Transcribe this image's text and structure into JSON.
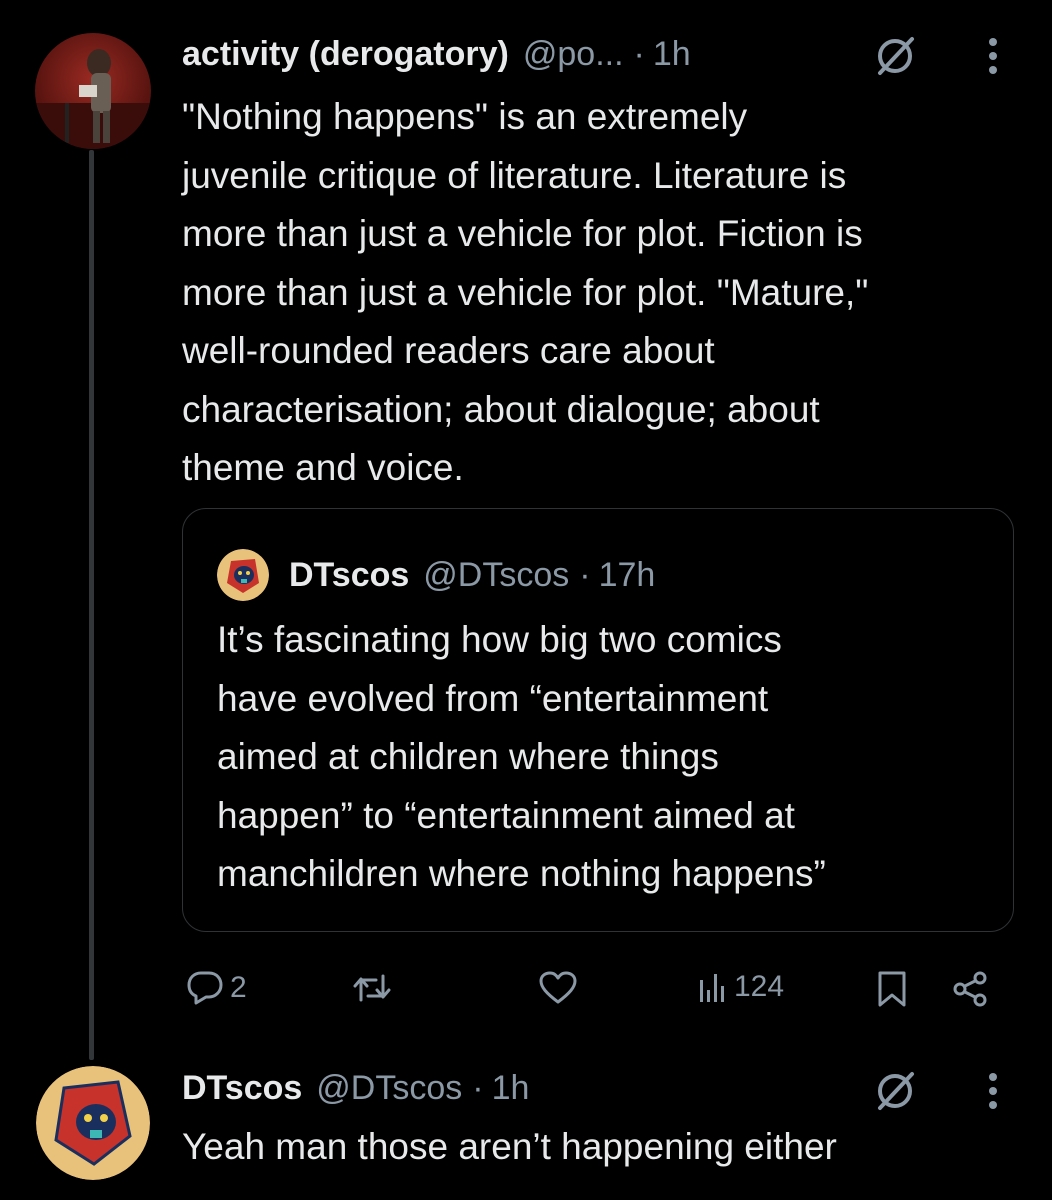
{
  "thread": {
    "main_tweet": {
      "display_name": "activity (derogatory)",
      "handle": "@po...",
      "separator": "·",
      "time": "1h",
      "text_lines": [
        "\"Nothing happens\" is an extremely",
        "juvenile critique of literature. Literature is",
        "more than just a vehicle for plot. Fiction is",
        "more than just a vehicle for plot. \"Mature,\"",
        "well-rounded readers care about",
        "characterisation; about dialogue; about",
        "theme and voice."
      ],
      "quoted": {
        "display_name": "DTscos",
        "handle": "@DTscos",
        "separator": "·",
        "time": "17h",
        "text_lines": [
          "It’s fascinating how big two comics",
          "have evolved from “entertainment",
          "aimed at children where things",
          "happen” to “entertainment aimed at",
          "manchildren where nothing happens”"
        ]
      },
      "actions": {
        "reply_count": "2",
        "retweet_count": "",
        "like_count": "",
        "views_count": "124"
      }
    },
    "reply_tweet": {
      "display_name": "DTscos",
      "handle": "@DTscos",
      "separator": "·",
      "time": "1h",
      "text": "Yeah man those aren’t happening either"
    }
  },
  "icons": {
    "reply": "reply-icon",
    "retweet": "retweet-icon",
    "like": "heart-icon",
    "views": "analytics-icon",
    "bookmark": "bookmark-icon",
    "share": "share-icon",
    "grok": "grok-icon",
    "more": "more-vertical-icon"
  },
  "colors": {
    "background": "#000000",
    "text_primary": "#e7e9ea",
    "text_secondary": "#8b98a5",
    "border": "#2f3336"
  }
}
